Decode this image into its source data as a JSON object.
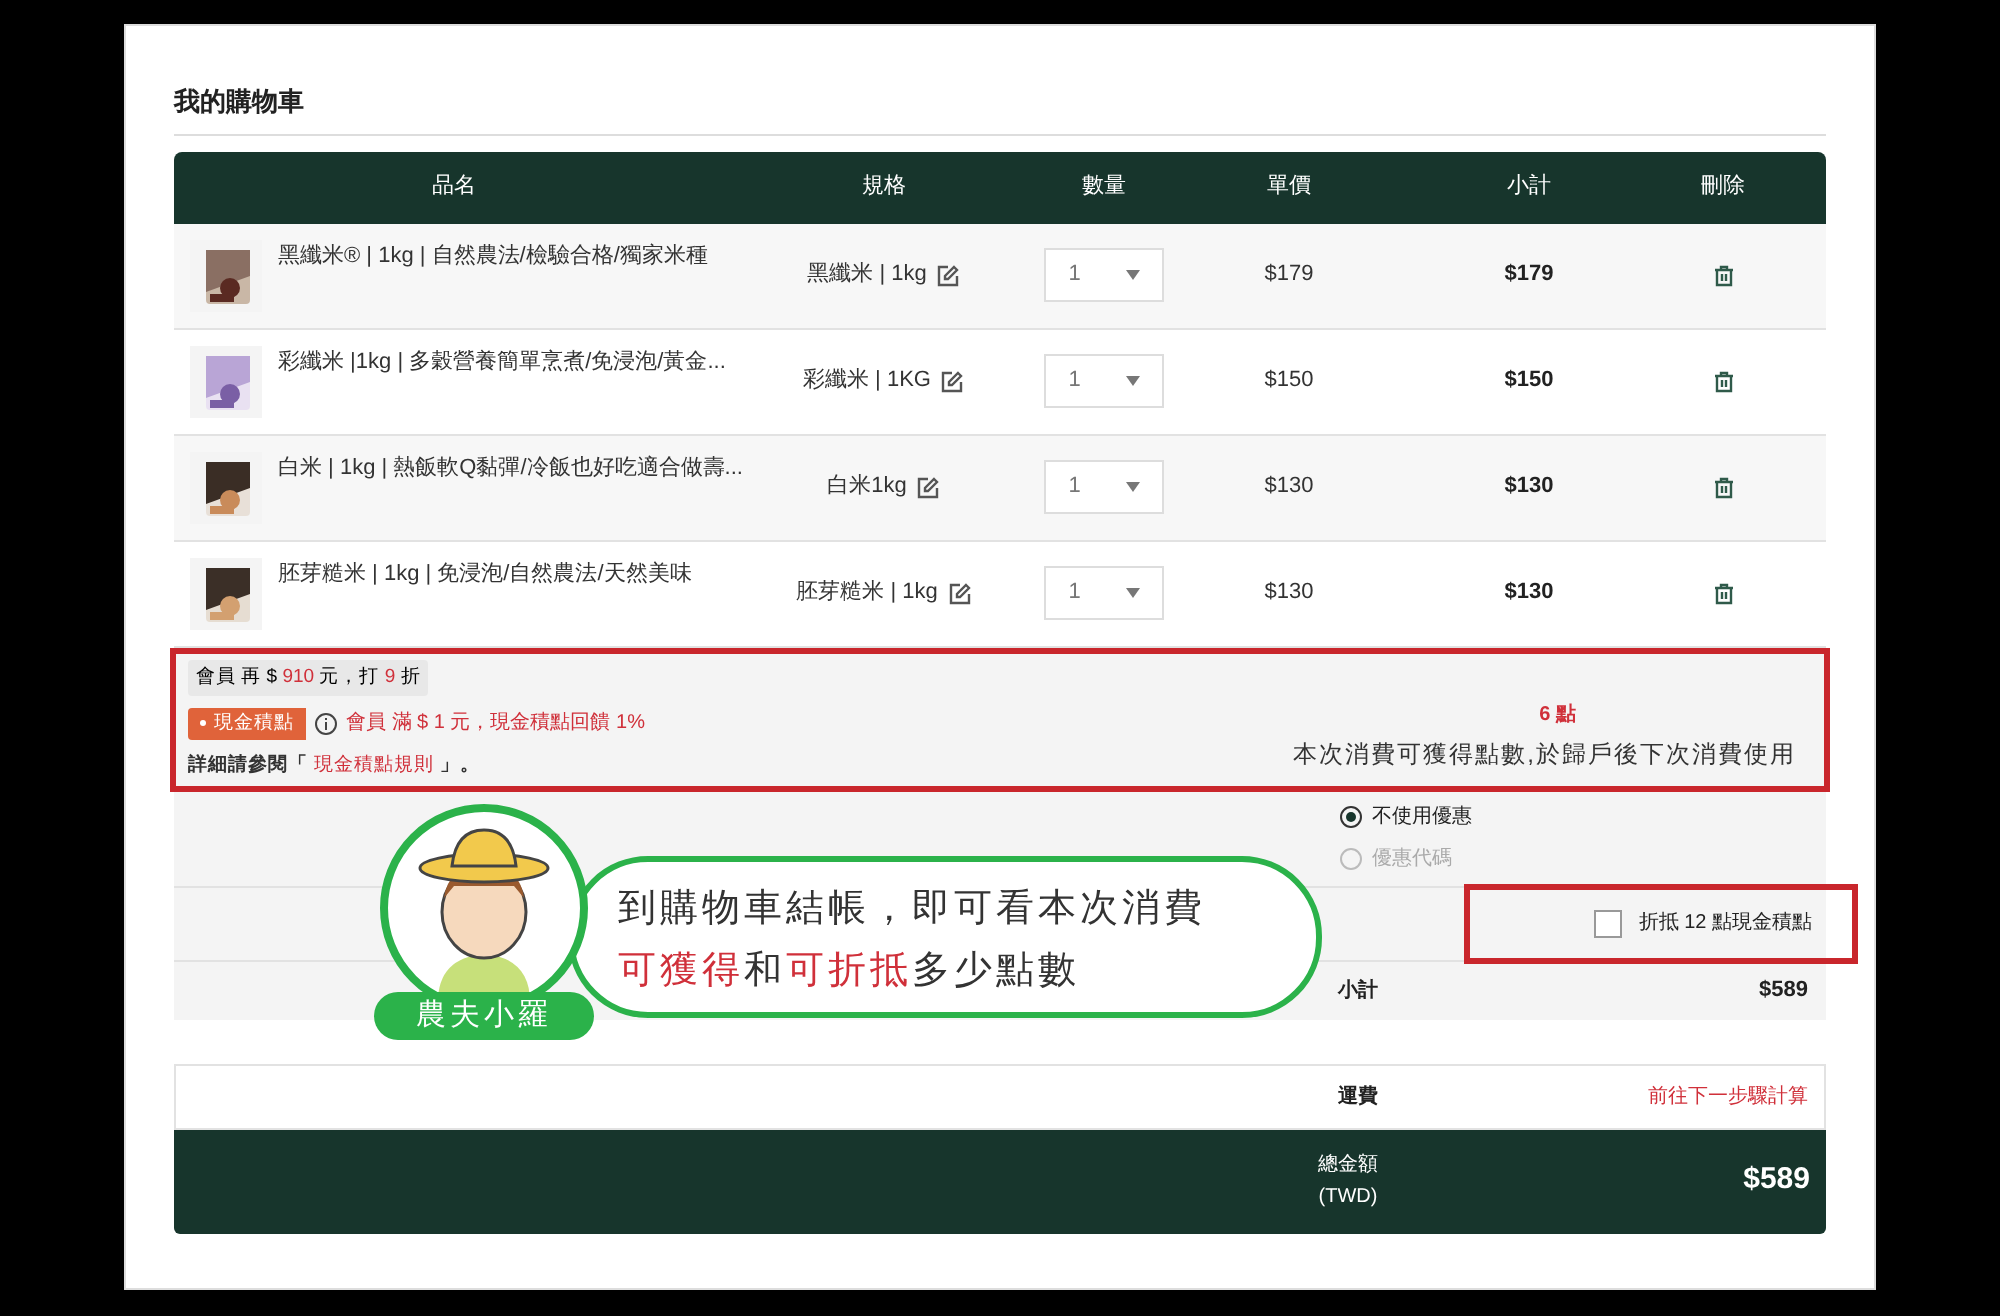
{
  "section_title": "我的購物車",
  "table": {
    "columns": [
      "品名",
      "規格",
      "數量",
      "單價",
      "小計",
      "刪除"
    ],
    "rows": [
      {
        "name": "黑纖米® | 1kg | 自然農法/檢驗合格/獨家米種",
        "spec": "黑纖米 | 1kg",
        "qty": "1",
        "unit_price": "$179",
        "subtotal": "$179"
      },
      {
        "name": "彩纖米 |1kg | 多穀營養簡單烹煮/免浸泡/黃金...",
        "spec": "彩纖米 | 1KG",
        "qty": "1",
        "unit_price": "$150",
        "subtotal": "$150"
      },
      {
        "name": "白米 | 1kg | 熱飯軟Q黏彈/冷飯也好吃適合做壽...",
        "spec": "白米1kg",
        "qty": "1",
        "unit_price": "$130",
        "subtotal": "$130"
      },
      {
        "name": "胚芽糙米 | 1kg | 免浸泡/自然農法/天然美味",
        "spec": "胚芽糙米 | 1kg",
        "qty": "1",
        "unit_price": "$130",
        "subtotal": "$130"
      }
    ]
  },
  "promo": {
    "member_note": [
      {
        "text": "會員 再 $ ",
        "kind": "plain"
      },
      {
        "text": "910",
        "kind": "highlight"
      },
      {
        "text": " 元，打 ",
        "kind": "plain"
      },
      {
        "text": "9",
        "kind": "highlight"
      },
      {
        "text": " 折",
        "kind": "plain"
      }
    ],
    "tag": "現金積點",
    "rule": "會員 滿 $ 1 元，現金積點回饋 1%",
    "details": {
      "before": "詳細請參閱「",
      "link": "現金積點規則",
      "after": "」。"
    },
    "points": "6 點",
    "points_note": "本次消費可獲得點數,於歸戶後下次消費使用"
  },
  "coupon_options": [
    {
      "label": "不使用優惠",
      "selected": true,
      "disabled": false
    },
    {
      "label": "優惠代碼",
      "selected": false,
      "disabled": true
    }
  ],
  "redeem": {
    "label": "折抵 12 點現金積點",
    "checked": false
  },
  "subtotal": {
    "label": "小計",
    "value": "$589"
  },
  "shipping": {
    "label": "運費",
    "value": "前往下一步驟計算"
  },
  "total": {
    "label": "總金額",
    "currency": "(TWD)",
    "value": "$589"
  },
  "callout": {
    "name": "農夫小羅",
    "lines": [
      [
        {
          "text": "到購物車結帳，即可看本次消費",
          "kind": "plain"
        }
      ],
      [
        {
          "text": "可獲得",
          "kind": "highlight"
        },
        {
          "text": "和",
          "kind": "plain"
        },
        {
          "text": "可折抵",
          "kind": "highlight"
        },
        {
          "text": "多少點數",
          "kind": "plain"
        }
      ]
    ]
  }
}
